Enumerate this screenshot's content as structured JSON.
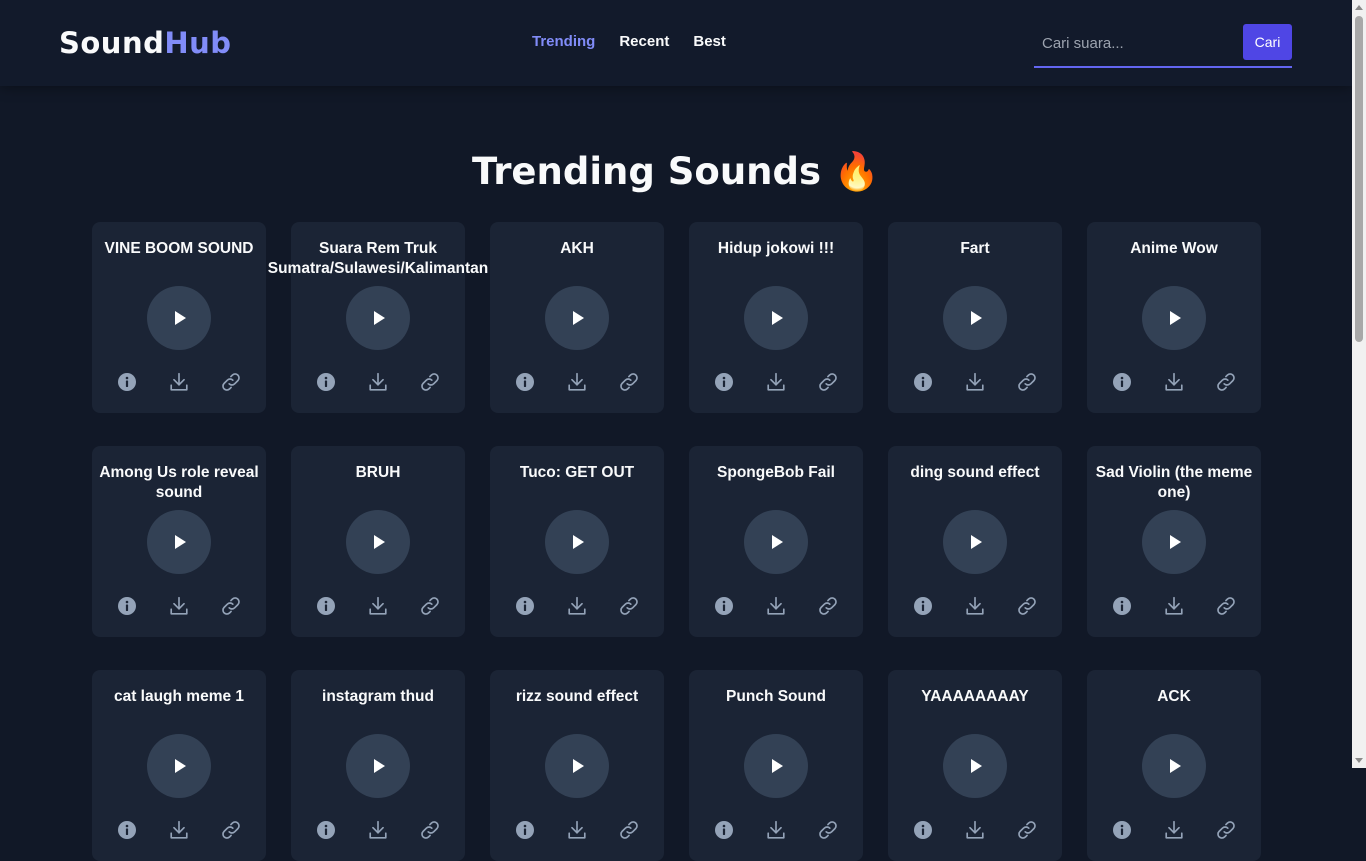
{
  "header": {
    "logo_part1": "Sound",
    "logo_part2": "Hub",
    "nav": [
      {
        "label": "Trending",
        "active": true
      },
      {
        "label": "Recent",
        "active": false
      },
      {
        "label": "Best",
        "active": false
      }
    ],
    "search": {
      "placeholder": "Cari suara...",
      "button_label": "Cari"
    }
  },
  "main": {
    "title": "Trending Sounds 🔥",
    "sounds": [
      {
        "title": "VINE BOOM SOUND"
      },
      {
        "title": "Suara Rem Truk Sumatra/Sulawesi/Kalimantan"
      },
      {
        "title": "AKH"
      },
      {
        "title": "Hidup jokowi !!!"
      },
      {
        "title": "Fart"
      },
      {
        "title": "Anime Wow"
      },
      {
        "title": "Among Us role reveal sound"
      },
      {
        "title": "BRUH"
      },
      {
        "title": "Tuco: GET OUT"
      },
      {
        "title": "SpongeBob Fail"
      },
      {
        "title": "ding sound effect"
      },
      {
        "title": "Sad Violin (the meme one)"
      },
      {
        "title": "cat laugh meme 1"
      },
      {
        "title": "instagram thud"
      },
      {
        "title": "rizz sound effect"
      },
      {
        "title": "Punch Sound"
      },
      {
        "title": "YAAAAAAAAY"
      },
      {
        "title": "ACK"
      }
    ]
  },
  "icons": {
    "play": "play-icon",
    "info": "info-icon",
    "download": "download-icon",
    "link": "link-icon"
  },
  "colors": {
    "background": "#111827",
    "card": "#1b2435",
    "accent": "#818cf8",
    "button": "#4f46e5",
    "icon": "#94a3b8"
  }
}
